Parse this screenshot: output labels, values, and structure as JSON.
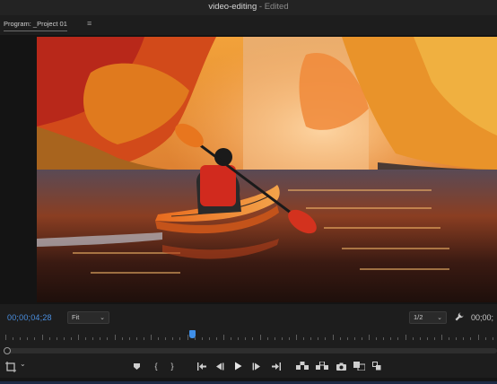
{
  "window": {
    "title": "video-editing",
    "separator": " - ",
    "status": "Edited"
  },
  "panel": {
    "tab_label": "Program: _Project 01",
    "menu_icon": "hamburger-icon"
  },
  "viewer": {
    "frame_description_icon": "video-frame"
  },
  "controls": {
    "current_timecode": "00;00;04;28",
    "zoom_value": "Fit",
    "resolution_value": "1/2",
    "end_timecode": "00;00;",
    "settings_icon": "wrench-icon"
  },
  "transport": {
    "buttons": [
      {
        "name": "add-marker-icon",
        "glyph": "marker"
      },
      {
        "name": "mark-in-icon",
        "glyph": "{"
      },
      {
        "name": "mark-out-icon",
        "glyph": "}"
      },
      {
        "name": "go-to-in-icon",
        "glyph": "{←"
      },
      {
        "name": "step-back-icon",
        "glyph": "◀|"
      },
      {
        "name": "play-icon",
        "glyph": "▶"
      },
      {
        "name": "step-forward-icon",
        "glyph": "|▶"
      },
      {
        "name": "go-to-out-icon",
        "glyph": "→}"
      },
      {
        "name": "lift-icon",
        "glyph": "lift"
      },
      {
        "name": "extract-icon",
        "glyph": "extract"
      },
      {
        "name": "export-frame-icon",
        "glyph": "camera"
      },
      {
        "name": "comparison-view-icon",
        "glyph": "compare"
      },
      {
        "name": "button-editor-icon",
        "glyph": "editor"
      }
    ]
  },
  "colors": {
    "accent": "#3f8fe8",
    "timecode": "#4a8fe0",
    "background": "#1d1d1d"
  }
}
